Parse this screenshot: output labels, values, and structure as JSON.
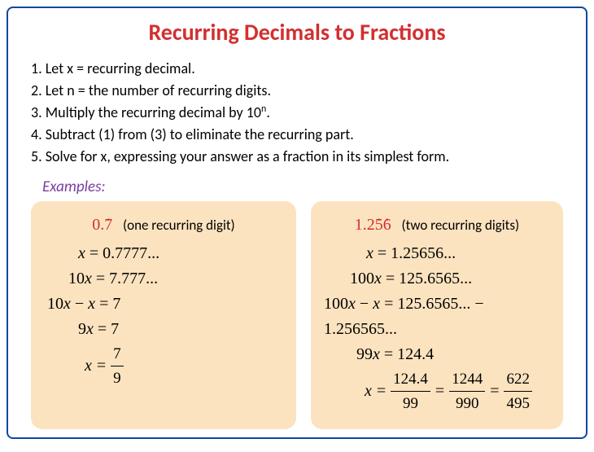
{
  "title": "Recurring Decimals to Fractions",
  "steps": {
    "s1": "1. Let x = recurring decimal.",
    "s2": "2. Let n = the number of recurring digits.",
    "s3": "3. Multiply the recurring decimal by 10",
    "s3_exp": "n",
    "s3_end": ".",
    "s4": "4. Subtract (1) from (3) to eliminate the recurring part.",
    "s5": "5. Solve for x, expressing your answer as a fraction in its simplest form."
  },
  "examples_label": "Examples:",
  "example1": {
    "decimal_whole": "0.",
    "decimal_rec": "7",
    "note": "(one recurring digit)",
    "line1_lhs": "x",
    "line1_eq": " = 0.7777...",
    "line2": "10",
    "line2_var": "x",
    "line2_eq": " = 7.777...",
    "line3": "10",
    "line3_varx": "x",
    "line3_minus": " − ",
    "line3_var2": "x",
    "line3_eq": " = 7",
    "line4": "9",
    "line4_var": "x",
    "line4_eq": " = 7",
    "line5_var": "x",
    "line5_eq": " = ",
    "frac_num": "7",
    "frac_den": "9"
  },
  "example2": {
    "decimal_whole": "1.2",
    "decimal_rec1": "5",
    "decimal_rec2": "6",
    "note": "(two recurring digits)",
    "line1_var": "x",
    "line1_eq": " = 1.25656...",
    "line2": "100",
    "line2_var": "x",
    "line2_eq": " = 125.6565...",
    "line3": "100",
    "line3_varx": "x",
    "line3_minus": " − ",
    "line3_var2": "x",
    "line3_eq": " = 125.6565... − 1.256565...",
    "line4": "99",
    "line4_var": "x",
    "line4_eq": " = 124.4",
    "line5_var": "x",
    "line5_eq": " = ",
    "f1_num": "124.4",
    "f1_den": "99",
    "f2_num": "1244",
    "f2_den": "990",
    "f3_num": "622",
    "f3_den": "495",
    "eq": "="
  }
}
